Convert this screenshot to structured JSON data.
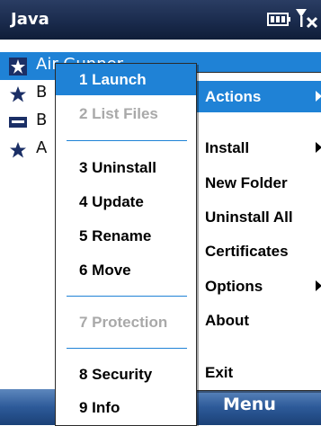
{
  "titlebar": {
    "title": "Java"
  },
  "list": {
    "items": [
      {
        "label": "Air Gunner"
      },
      {
        "label": "B"
      },
      {
        "label": "B"
      },
      {
        "label": "A"
      }
    ]
  },
  "softkeys": {
    "right": "Menu"
  },
  "main_menu": {
    "items": [
      {
        "label": "Actions"
      },
      {
        "label": "Install"
      },
      {
        "label": "New Folder"
      },
      {
        "label": "Uninstall All"
      },
      {
        "label": "Certificates"
      },
      {
        "label": "Options"
      },
      {
        "label": "About"
      },
      {
        "label": "Exit"
      }
    ]
  },
  "actions_menu": {
    "items": [
      {
        "label": "1 Launch"
      },
      {
        "label": "2 List Files"
      },
      {
        "label": "3 Uninstall"
      },
      {
        "label": "4 Update"
      },
      {
        "label": "5 Rename"
      },
      {
        "label": "6 Move"
      },
      {
        "label": "7 Protection"
      },
      {
        "label": "8 Security"
      },
      {
        "label": "9 Info"
      }
    ]
  },
  "colors": {
    "highlight": "#1f82d6",
    "titlebar": "#1a2b4d",
    "disabled_text": "#a9a9a9"
  }
}
